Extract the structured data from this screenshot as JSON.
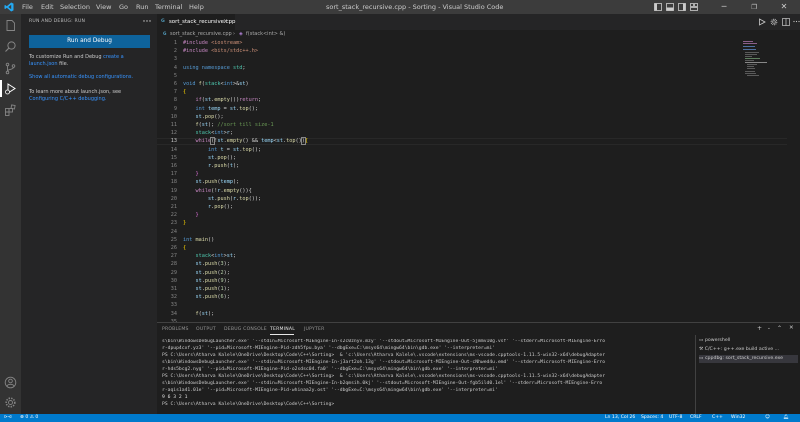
{
  "titlebar": {
    "menu": [
      "File",
      "Edit",
      "Selection",
      "View",
      "Go",
      "Run",
      "Terminal",
      "Help"
    ],
    "title": "sort_stack_recursive.cpp - Sorting - Visual Studio Code"
  },
  "sidebar": {
    "title": "RUN AND DEBUG: RUN",
    "run_button": "Run and Debug",
    "customize_text": "To customize Run and Debug",
    "customize_link": "create a",
    "customize_link2": "launch.json",
    "customize_tail": "file.",
    "show_all": "Show all automatic debug configurations.",
    "learn_more": "To learn more about launch.json, see",
    "configuring_link": "Configuring C/C++ debugging."
  },
  "editor": {
    "tab_label": "sort_stack_recursive.cpp",
    "breadcrumb_file": "sort_stack_recursive.cpp",
    "breadcrumb_symbol": "f(stack<int> &)",
    "line_numbers": [
      "1",
      "2",
      "3",
      "4",
      "5",
      "6",
      "7",
      "8",
      "9",
      "10",
      "11",
      "12",
      "13",
      "14",
      "15",
      "16",
      "17",
      "18",
      "19",
      "20",
      "21",
      "22",
      "23",
      "24",
      "25",
      "26",
      "27",
      "28",
      "29",
      "30",
      "31",
      "32",
      "33",
      "34",
      "35",
      "36",
      "37",
      "38"
    ],
    "current_line": "13"
  },
  "panel": {
    "tabs": [
      "PROBLEMS",
      "OUTPUT",
      "DEBUG CONSOLE",
      "TERMINAL",
      "JUPYTER"
    ],
    "active_tab": "TERMINAL",
    "terminal_lines": [
      "s\\bin\\WindowsDebugLauncher.exe' '--stdin=Microsoft-MIEngine-In-s2c0znyv.mzy' '--stdout=Microsoft-MIEngine-Out-5jmmv10g.vsf' '--stderr=Microsoft-MIEngine-Erro",
      "r-dpup4cxf.yz3' '--pid=Microsoft-MIEngine-Pid-zdh5fpu.bya' '--dbgExe=C:\\msys64\\mingw64\\bin\\gdb.exe' '--interpreter=mi'",
      "PS C:\\Users\\Atharva Kalele\\OneDrive\\Desktop\\Code\\C++\\Sorting>  & 'c:\\Users\\Atharva Kalele\\.vscode\\extensions\\ms-vscode.cpptools-1.11.5-win32-x64\\debugAdapter",
      "s\\bin\\WindowsDebugLauncher.exe' '--stdin=Microsoft-MIEngine-In-j3art2oh.13g' '--stdout=Microsoft-MIEngine-Out-cNhwed4u.emd' '--stderr=Microsoft-MIEngine-Erro",
      "r-hds5bcg2.nyg' '--pid=Microsoft-MIEngine-Pid-o2sdsc04.fa0' '--dbgExe=C:\\msys64\\mingw64\\bin\\gdb.exe' '--interpreter=mi'",
      "PS C:\\Users\\Atharva Kalele\\OneDrive\\Desktop\\Code\\C++\\Sorting>  & 'c:\\Users\\Atharva Kalele\\.vscode\\extensions\\ms-vscode.cpptools-1.11.5-win32-x64\\debugAdapter",
      "s\\bin\\WindowsDebugLauncher.exe' '--stdin=Microsoft-MIEngine-In-b2qmsih.0kj' '--stdout=Microsoft-MIEngine-Out-fgb5ild0.1el' '--stderr=Microsoft-MIEngine-Erro",
      "r-aqis1a41.01e' '--pid=Microsoft-MIEngine-Pid-whinaa2y.ost' '--dbgExe=C:\\msys64\\mingw64\\bin\\gdb.exe' '--interpreter=mi'",
      "9 6 3 2 1",
      "PS C:\\Users\\Atharva Kalele\\OneDrive\\Desktop\\Code\\C++\\Sorting>"
    ],
    "terminal_instances": [
      "powershell",
      "C/C++: g++.exe build active ...",
      "cppdbg: sort_stack_recursive.exe"
    ]
  },
  "statusbar": {
    "errors": "0",
    "warnings": "0",
    "position": "Ln 13, Col 26",
    "spaces": "Spaces: 4",
    "encoding": "UTF-8",
    "eol": "CRLF",
    "language": "C++",
    "platform": "Win32"
  },
  "colors": {
    "accent": "#007acc",
    "button": "#0e639c",
    "titlebar": "#3c3c3c",
    "sidebar": "#252526",
    "editor": "#1e1e1e"
  }
}
